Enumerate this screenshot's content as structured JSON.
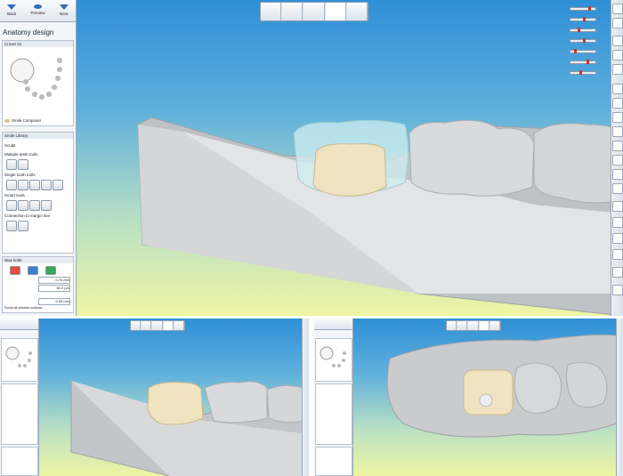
{
  "nav": {
    "back": "Back",
    "preview": "Preview",
    "next": "Next"
  },
  "panel": {
    "title": "Anatomy design",
    "crown_label": "Crown 31",
    "smile_composer": "Smile Composer",
    "smile_library": "Smile Library",
    "sculpt": "Sculpt",
    "multiple_teeth": "Multiple teeth tools",
    "single_tooth": "Single tooth tools",
    "smart_tools": "Smart tools",
    "connection_margin": "Connection to margin line",
    "wax_knife": "Wax knife",
    "value1": "0.76 mm",
    "value2": "50.0 µm",
    "value3": "0.00 mm",
    "sculpt_checkbox": "Sculpt all selected surfaces"
  },
  "colors": {
    "accent": "#2f8fd6",
    "crown_cream": "#efe4bf",
    "gum_grey": "#c9cbcd"
  }
}
